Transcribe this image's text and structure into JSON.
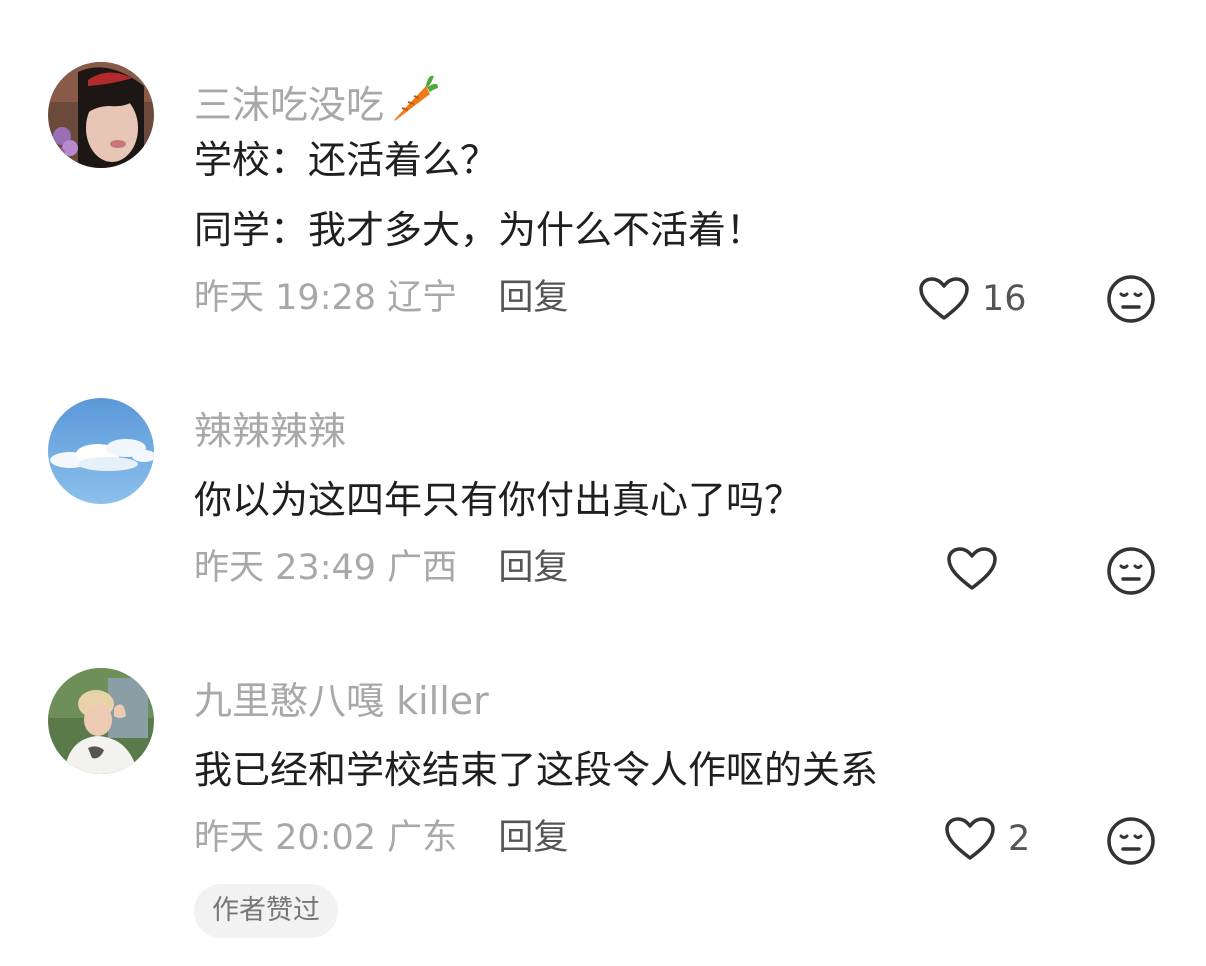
{
  "comments": [
    {
      "username": "三沫吃没吃",
      "username_emoji": "carrot-icon",
      "lines": [
        "学校：还活着么？",
        "同学：我才多大，为什么不活着！"
      ],
      "date": "昨天",
      "time": "19:28",
      "location": "辽宁",
      "reply_label": "回复",
      "likes": "16"
    },
    {
      "username": "辣辣辣辣",
      "lines": [
        "你以为这四年只有你付出真心了吗？"
      ],
      "date": "昨天",
      "time": "23:49",
      "location": "广西",
      "reply_label": "回复",
      "likes": ""
    },
    {
      "username": "九里憨八嘎 killer",
      "lines": [
        "我已经和学校结束了这段令人作呕的关系"
      ],
      "date": "昨天",
      "time": "20:02",
      "location": "广东",
      "reply_label": "回复",
      "likes": "2",
      "badge": "作者赞过"
    }
  ],
  "icons": {
    "like": "heart-outline-icon",
    "dislike": "neutral-face-icon"
  },
  "colors": {
    "username": "#a8a8a8",
    "text": "#1f1f1f",
    "meta": "#a8a8a8",
    "reply": "#555555",
    "badge_bg": "#f2f2f2"
  }
}
